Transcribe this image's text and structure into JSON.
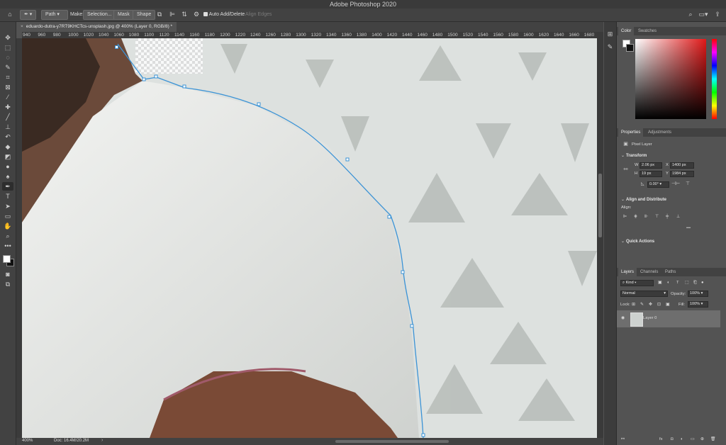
{
  "app": {
    "title": "Adobe Photoshop 2020"
  },
  "options_bar": {
    "mode": "Path",
    "make_label": "Make:",
    "selection_label": "Selection...",
    "mask_label": "Mask",
    "shape_label": "Shape",
    "auto_add_label": "Auto Add/Delete",
    "align_edges_label": "Align Edges"
  },
  "document": {
    "tab_title": "eduardo-dutra-y7RT9KHCTcs-unsplash.jpg @ 400% (Layer 0, RGB/8) *",
    "zoom": "400%",
    "doc_info": "Doc: 16.4M/20.2M"
  },
  "ruler_ticks": [
    "940",
    "960",
    "980",
    "1000",
    "1020",
    "1040",
    "1060",
    "1080",
    "1100",
    "1120",
    "1140",
    "1160",
    "1180",
    "1200",
    "1220",
    "1240",
    "1260",
    "1280",
    "1300",
    "1320",
    "1340",
    "1360",
    "1380",
    "1400",
    "1420",
    "1440",
    "1460",
    "1480",
    "1500",
    "1520",
    "1540",
    "1560",
    "1580",
    "1600",
    "1620",
    "1640",
    "1660",
    "1680"
  ],
  "color_panel": {
    "tabs": [
      "Color",
      "Swatches"
    ],
    "accent": "#e01818"
  },
  "properties_panel": {
    "tabs": [
      "Properties",
      "Adjustments"
    ],
    "layer_type": "Pixel Layer",
    "transform_title": "Transform",
    "w_label": "W",
    "w_value": "2.06 px",
    "h_label": "H",
    "h_value": "19 px",
    "x_label": "X",
    "x_value": "1400 px",
    "y_label": "Y",
    "y_value": "1984 px",
    "angle_value": "0.00°",
    "align_title": "Align and Distribute",
    "align_label": "Align:",
    "quick_title": "Quick Actions"
  },
  "layers_panel": {
    "tabs": [
      "Layers",
      "Channels",
      "Paths"
    ],
    "filter_kind": "Kind",
    "blend_mode": "Normal",
    "opacity_label": "Opacity:",
    "opacity_value": "100%",
    "lock_label": "Lock:",
    "fill_label": "Fill:",
    "fill_value": "100%",
    "layer_name": "Layer 0"
  }
}
